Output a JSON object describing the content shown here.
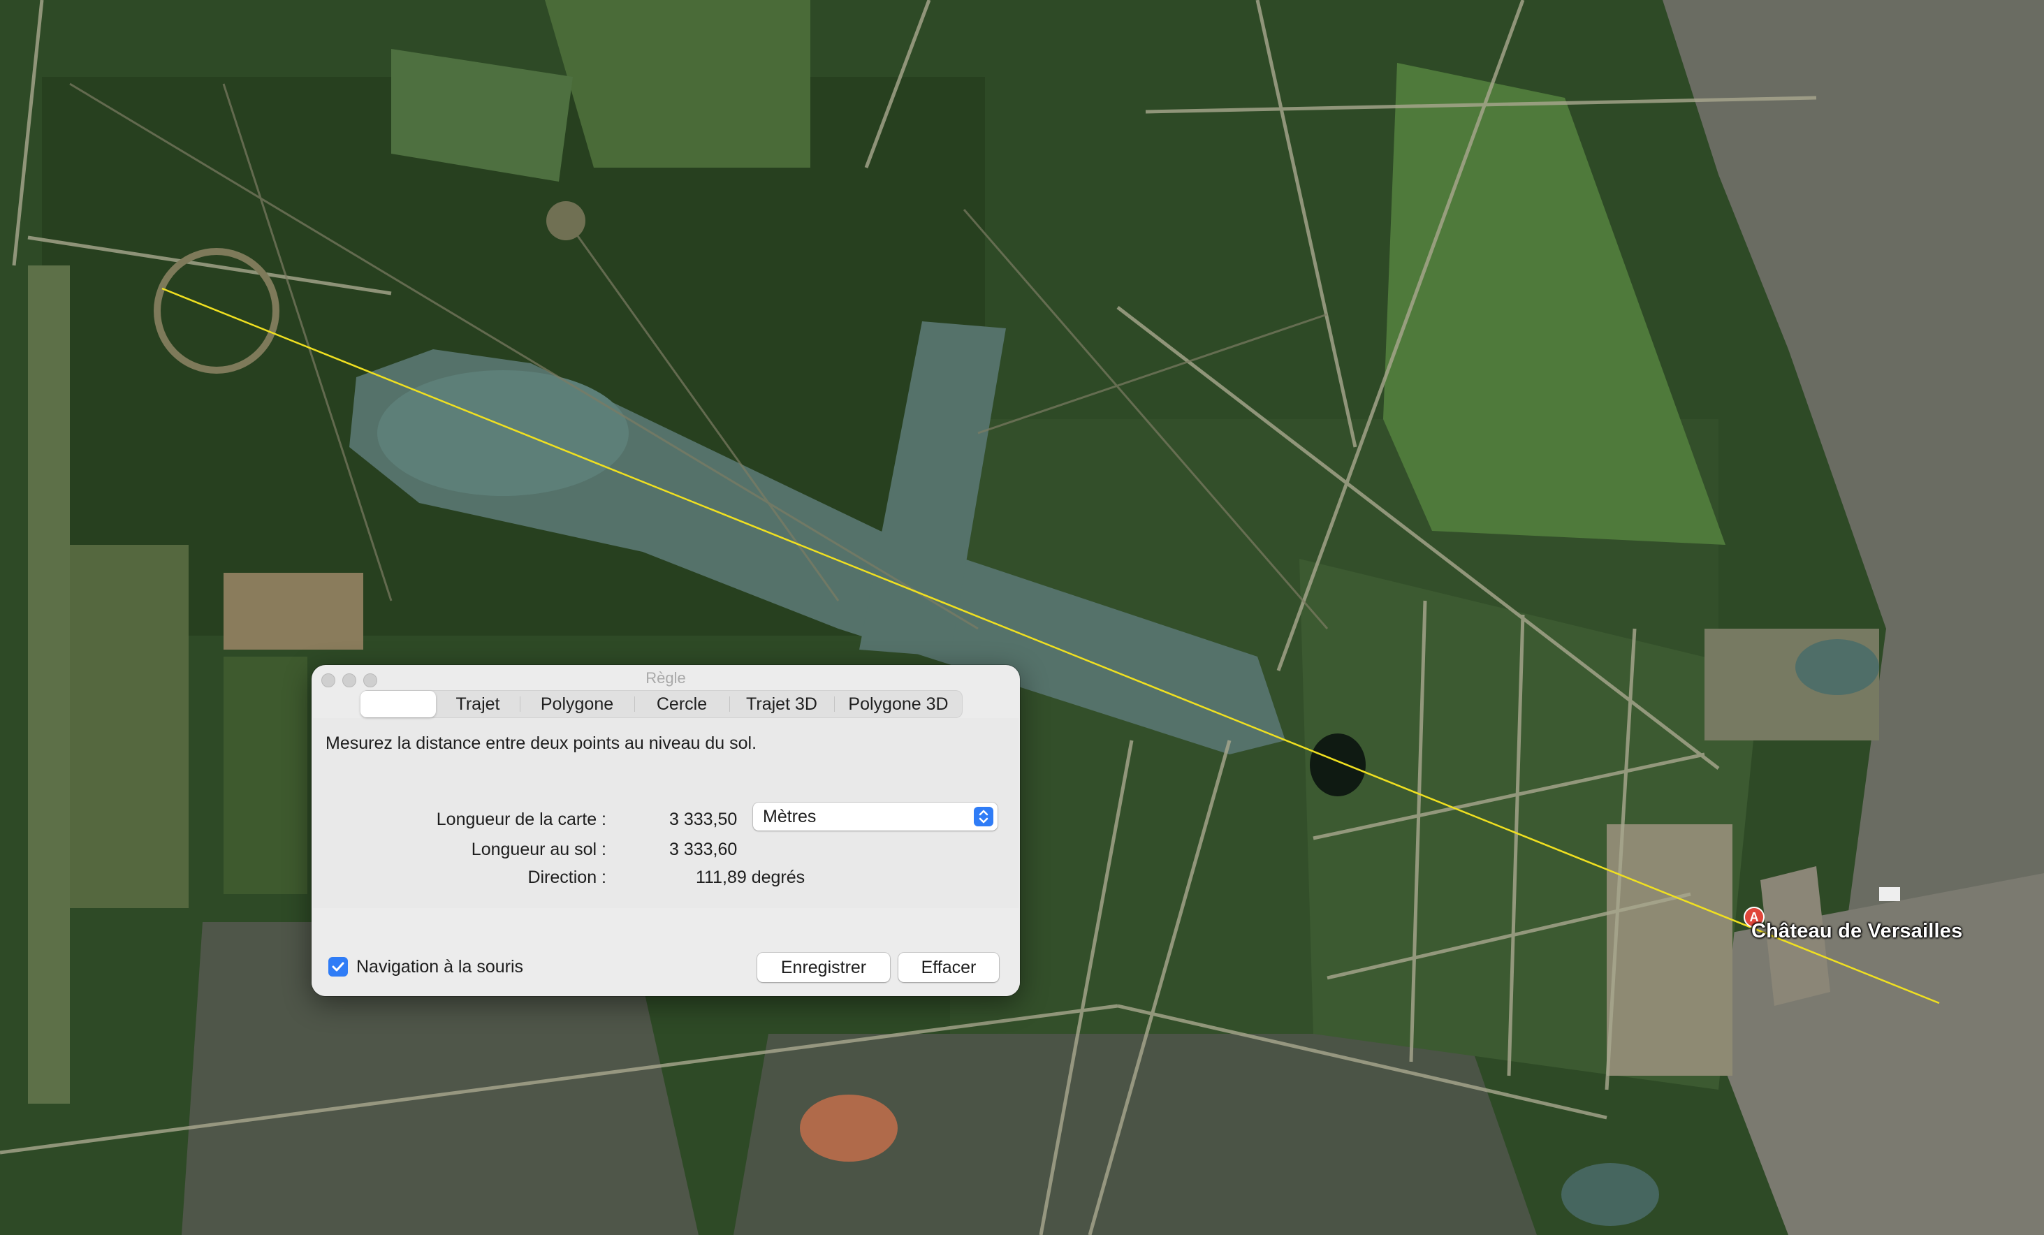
{
  "map": {
    "place_label": "Château de Versailles",
    "pin_letter": "A",
    "ruler_line_color": "#f0e020"
  },
  "dialog": {
    "title": "Règle",
    "tabs": [
      {
        "label": "",
        "selected": true
      },
      {
        "label": "Trajet",
        "selected": false
      },
      {
        "label": "Polygone",
        "selected": false
      },
      {
        "label": "Cercle",
        "selected": false
      },
      {
        "label": "Trajet 3D",
        "selected": false
      },
      {
        "label": "Polygone 3D",
        "selected": false
      }
    ],
    "description": "Mesurez la distance entre deux points au niveau du sol.",
    "map_length": {
      "label": "Longueur de la carte :",
      "value": "3 333,50"
    },
    "unit": {
      "selected": "Mètres"
    },
    "ground_length": {
      "label": "Longueur au sol :",
      "value": "3 333,60"
    },
    "heading": {
      "label": "Direction :",
      "value": "111,89 degrés"
    },
    "mouse_navigation": {
      "label": "Navigation à la souris",
      "checked": true
    },
    "save_label": "Enregistrer",
    "clear_label": "Effacer",
    "accent_color": "#2f7cf6"
  }
}
